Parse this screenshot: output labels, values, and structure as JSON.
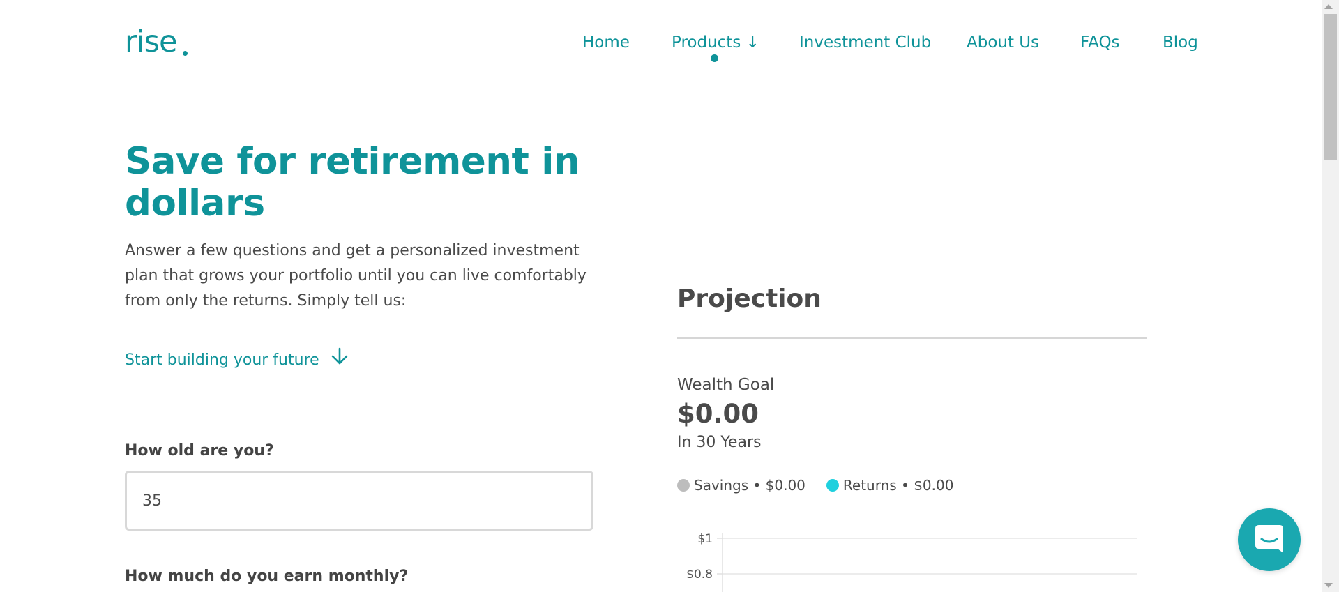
{
  "brand": {
    "logo_text": "rise",
    "accent_color": "#0f9399"
  },
  "nav": {
    "items": [
      {
        "label": "Home"
      },
      {
        "label": "Products ↓",
        "active": true
      },
      {
        "label": "Investment Club"
      },
      {
        "label": "About Us"
      },
      {
        "label": "FAQs"
      },
      {
        "label": "Blog"
      }
    ]
  },
  "hero": {
    "title": "Save for retirement in dollars",
    "description": "Answer a few questions and get a personalized investment plan that grows your portfolio until you can live comfortably from only the returns. Simply tell us:",
    "cta": "Start building your future",
    "cta_icon": "arrow-down-icon"
  },
  "form": {
    "age_question": "How old are you?",
    "age_value": "35",
    "earnings_question": "How much do you earn monthly?"
  },
  "projection": {
    "title": "Projection",
    "wealth_goal_label": "Wealth Goal",
    "wealth_goal_value": "$0.00",
    "horizon": "In 30 Years",
    "legend": [
      {
        "label": "Savings • $0.00",
        "color": "#bdbdbd"
      },
      {
        "label": "Returns • $0.00",
        "color": "#1fd0de"
      }
    ]
  },
  "chart_data": {
    "type": "area",
    "series": [
      {
        "name": "Savings",
        "values": []
      },
      {
        "name": "Returns",
        "values": []
      }
    ],
    "y_ticks": [
      "$1",
      "$0.8"
    ],
    "grid": true
  },
  "chat": {
    "icon": "chat-bubble-icon",
    "color": "#1aa8b0"
  }
}
